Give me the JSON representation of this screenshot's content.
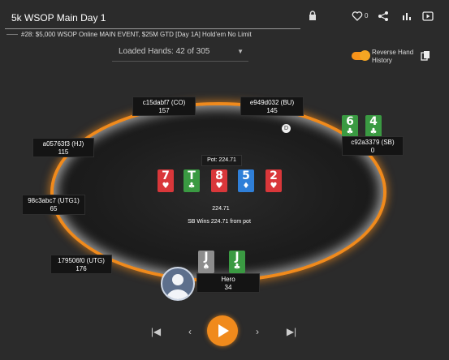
{
  "header": {
    "title": "5k WSOP Main Day 1",
    "heart_count": "0",
    "subtitle": "#28: $5,000 WSOP Online MAIN EVENT, $25M GTD [Day 1A] Hold'em No Limit"
  },
  "loaded_hands": "Loaded Hands: 42 of 305",
  "reverse_toggle": {
    "label_line1": "Reverse Hand",
    "label_line2": "History",
    "on": true
  },
  "seats": {
    "co": {
      "name": "c15dabf7 (CO)",
      "stack": "157"
    },
    "bu": {
      "name": "e949d032 (BU)",
      "stack": "145"
    },
    "hj": {
      "name": "a05763f3 (HJ)",
      "stack": "115"
    },
    "sb": {
      "name": "c92a3379 (SB)",
      "stack": "0"
    },
    "utg1": {
      "name": "98c3abc7 (UTG1)",
      "stack": "65"
    },
    "utg": {
      "name": "179506f0 (UTG)",
      "stack": "176"
    },
    "hero": {
      "name": "Hero",
      "stack": "34"
    }
  },
  "sb_cards": [
    {
      "rank": "6",
      "suit": "♣",
      "color": "#3a9a42"
    },
    {
      "rank": "4",
      "suit": "♣",
      "color": "#3a9a42"
    }
  ],
  "hero_cards": [
    {
      "rank": "J",
      "suit": "♠",
      "color": "#8d8d8d"
    },
    {
      "rank": "J",
      "suit": "♣",
      "color": "#3a9a42"
    }
  ],
  "board": [
    {
      "rank": "7",
      "suit": "♥",
      "color": "#d9373a"
    },
    {
      "rank": "T",
      "suit": "♣",
      "color": "#3a9a42"
    },
    {
      "rank": "8",
      "suit": "♥",
      "color": "#d9373a"
    },
    {
      "rank": "5",
      "suit": "♦",
      "color": "#2f7fd8"
    },
    {
      "rank": "2",
      "suit": "♥",
      "color": "#d9373a"
    }
  ],
  "pot_label": "Pot: 224.71",
  "pot_amount": "224.71",
  "winner_text": "SB Wins 224.71 from pot",
  "dealer_button": "D",
  "controls": {
    "first": "|◀",
    "prev": "‹",
    "next": "›",
    "last": "▶|"
  },
  "colors": {
    "accent": "#f08a1c",
    "background": "#2b2b2b"
  },
  "icons": [
    "lock-icon",
    "heart-icon",
    "share-icon",
    "stats-icon",
    "video-icon",
    "copy-icon",
    "avatar-icon",
    "play-icon"
  ]
}
